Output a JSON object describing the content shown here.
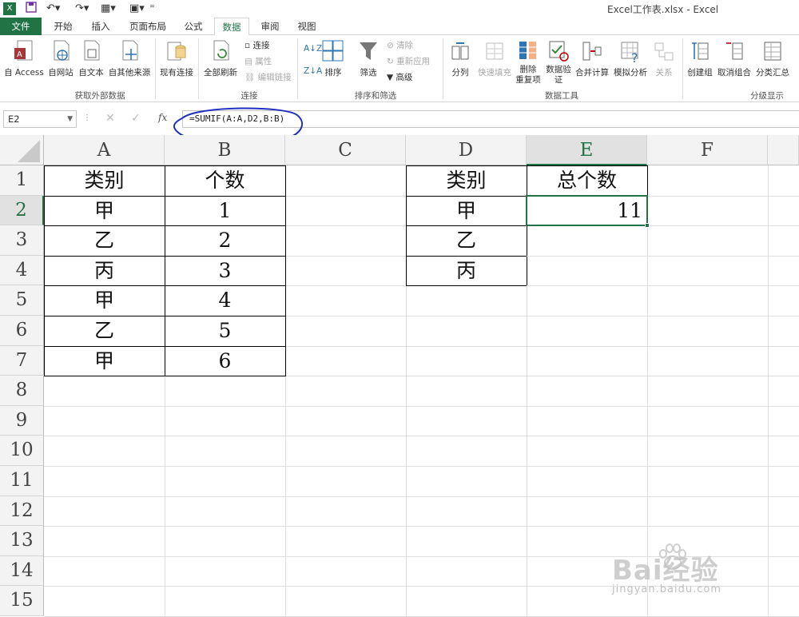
{
  "window": {
    "title": "Excel工作表.xlsx - Excel"
  },
  "tabs": [
    {
      "label": "文件"
    },
    {
      "label": "开始"
    },
    {
      "label": "插入"
    },
    {
      "label": "页面布局"
    },
    {
      "label": "公式"
    },
    {
      "label": "数据"
    },
    {
      "label": "审阅"
    },
    {
      "label": "视图"
    }
  ],
  "ribbon": {
    "external": {
      "access": "自 Access",
      "web": "自网站",
      "text": "自文本",
      "other": "自其他来源",
      "existing": "现有连接",
      "group": "获取外部数据"
    },
    "connections": {
      "refresh": "全部刷新",
      "conn": "连接",
      "props": "属性",
      "edit": "编辑链接",
      "group": "连接"
    },
    "sort": {
      "sort": "排序",
      "filter": "筛选",
      "clear": "清除",
      "reapply": "重新应用",
      "advanced": "高级",
      "group": "排序和筛选"
    },
    "tools": {
      "split": "分列",
      "flash": "快速填充",
      "remove1": "删除",
      "remove2": "重复项",
      "valid1": "数据验",
      "valid2": "证",
      "consol": "合并计算",
      "whatif": "模拟分析",
      "rel": "关系",
      "group": "数据工具"
    },
    "outline": {
      "groupbtn": "创建组",
      "ungroup": "取消组合",
      "subtotal": "分类汇总",
      "group": "分级显示"
    },
    "sort_icons": {
      "az": "A↓Z",
      "za": "Z↓A",
      "zaz": "ZA AZ"
    }
  },
  "formula": {
    "namebox": "E2",
    "fx": "fx",
    "content": "=SUMIF(A:A,D2,B:B)"
  },
  "columns": [
    "A",
    "B",
    "C",
    "D",
    "E",
    "F"
  ],
  "rows": [
    "1",
    "2",
    "3",
    "4",
    "5",
    "6",
    "7",
    "8",
    "9",
    "10",
    "11",
    "12",
    "13",
    "14",
    "15"
  ],
  "table1": {
    "header": [
      "类别",
      "个数"
    ],
    "rows": [
      [
        "甲",
        "1"
      ],
      [
        "乙",
        "2"
      ],
      [
        "丙",
        "3"
      ],
      [
        "甲",
        "4"
      ],
      [
        "乙",
        "5"
      ],
      [
        "甲",
        "6"
      ]
    ]
  },
  "table2": {
    "header": [
      "类别",
      "总个数"
    ],
    "rows": [
      [
        "甲",
        "11"
      ],
      [
        "乙",
        ""
      ],
      [
        "丙",
        ""
      ]
    ]
  },
  "watermark": {
    "brand": "Bai经验",
    "url": "jingyan.baidu.com"
  },
  "colors": {
    "excel_green": "#217346",
    "annotation": "#1f2fbf"
  }
}
